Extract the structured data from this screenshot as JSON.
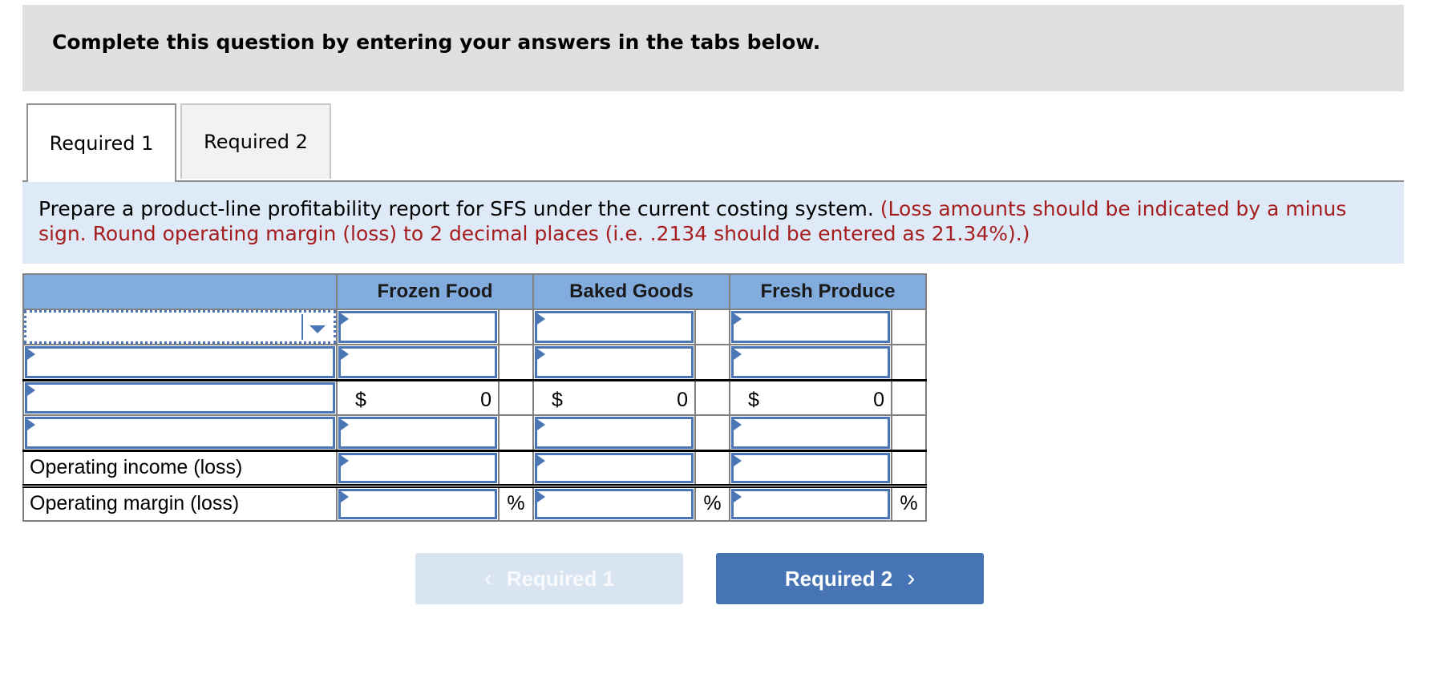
{
  "banner": {
    "text": "Complete this question by entering your answers in the tabs below."
  },
  "tabs": [
    {
      "label": "Required 1",
      "active": true
    },
    {
      "label": "Required 2",
      "active": false
    }
  ],
  "instructions": {
    "main": "Prepare a product-line profitability report for SFS under the current costing system.",
    "note": "(Loss amounts should be indicated by a minus sign. Round operating margin (loss) to 2 decimal places (i.e. .2134 should be entered as 21.34%).)"
  },
  "table": {
    "columns": [
      "",
      "Frozen Food",
      "Baked Goods",
      "Fresh Produce"
    ],
    "rows": [
      {
        "label": "",
        "type": "select",
        "values": [
          "",
          "",
          ""
        ]
      },
      {
        "label": "",
        "type": "input",
        "values": [
          "",
          "",
          ""
        ]
      },
      {
        "label": "",
        "type": "computed",
        "currency": "$",
        "values": [
          "0",
          "0",
          "0"
        ]
      },
      {
        "label": "",
        "type": "input",
        "values": [
          "",
          "",
          ""
        ]
      },
      {
        "label": "Operating income (loss)",
        "type": "input",
        "values": [
          "",
          "",
          ""
        ]
      },
      {
        "label": "Operating margin (loss)",
        "type": "input",
        "suffix": "%",
        "values": [
          "",
          "",
          ""
        ]
      }
    ]
  },
  "nav": {
    "prev_label": "Required 1",
    "next_label": "Required 2",
    "prev_icon": "chevron-left-icon",
    "next_icon": "chevron-right-icon"
  },
  "colors": {
    "accent": "#4774b4",
    "header_bg": "#82acde",
    "instruction_bg": "#deeaf7",
    "note_red": "#a51d1d"
  }
}
